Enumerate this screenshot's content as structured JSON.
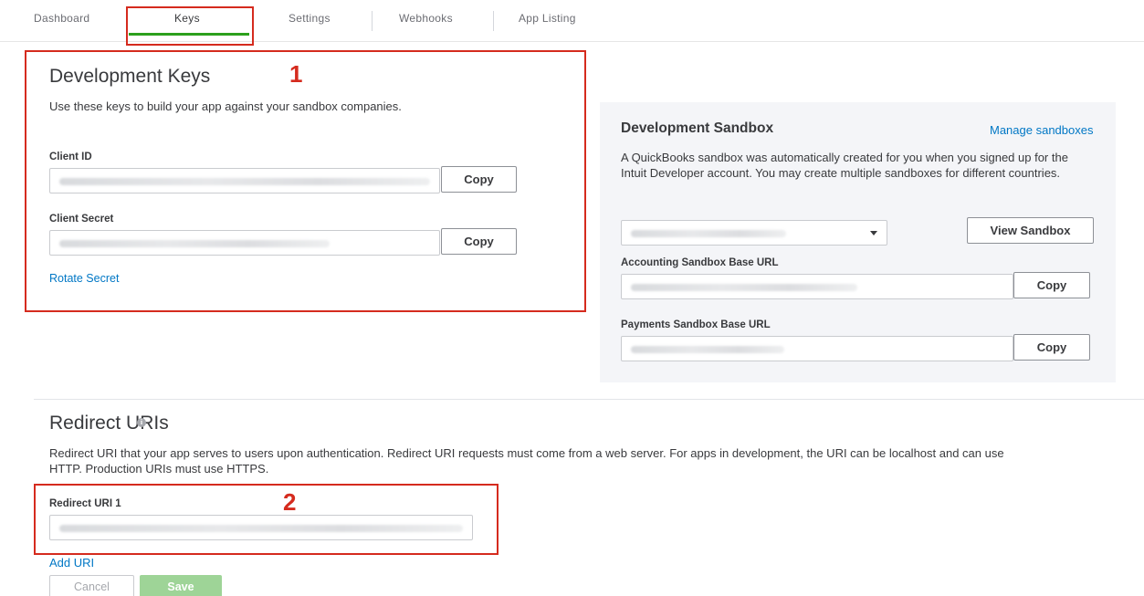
{
  "tabs": [
    {
      "label": "Dashboard"
    },
    {
      "label": "Keys"
    },
    {
      "label": "Settings"
    },
    {
      "label": "Webhooks"
    },
    {
      "label": "App Listing"
    }
  ],
  "annotations": {
    "marker1": "1",
    "marker2": "2"
  },
  "dev_keys": {
    "title": "Development Keys",
    "description": "Use these keys to build your app against your sandbox companies.",
    "client_id_label": "Client ID",
    "client_secret_label": "Client Secret",
    "copy_label": "Copy",
    "rotate_label": "Rotate Secret"
  },
  "sandbox": {
    "title": "Development Sandbox",
    "manage_link": "Manage sandboxes",
    "description": "A QuickBooks sandbox was automatically created for you when you signed up for the Intuit Developer account. You may create multiple sandboxes for different countries.",
    "view_button": "View Sandbox",
    "accounting_label": "Accounting Sandbox Base URL",
    "payments_label": "Payments Sandbox Base URL",
    "copy_label": "Copy"
  },
  "redirect": {
    "title": "Redirect URIs",
    "description": "Redirect URI that your app serves to users upon authentication. Redirect URI requests must come from a web server. For apps in development, the URI can be localhost and can use HTTP. Production URIs must use HTTPS.",
    "uri1_label": "Redirect URI 1",
    "add_uri": "Add URI",
    "cancel": "Cancel",
    "save": "Save"
  },
  "colors": {
    "accent_green": "#2ca01c",
    "link_blue": "#0077c5",
    "annotation_red": "#d52b1e"
  }
}
